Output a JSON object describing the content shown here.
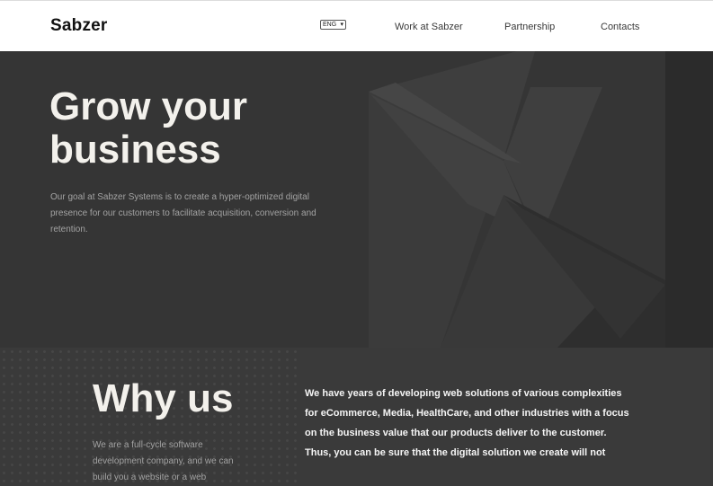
{
  "header": {
    "logo": "Sabzer",
    "language": "ENG",
    "nav": {
      "work": "Work at Sabzer",
      "partnership": "Partnership",
      "contacts": "Contacts"
    }
  },
  "hero": {
    "title": "Grow your business",
    "description": "Our goal at Sabzer Systems is to create a hyper-optimized digital presence for our customers to facilitate acquisition, conversion and retention."
  },
  "why": {
    "title": "Why us",
    "subtitle": "We are a full-cycle software development company, and we can build you a website or a web",
    "body_line1": "We have years of developing web solutions of various complexities for eCommerce, Media, HealthCare, and other industries with a focus on the business value that our products deliver to the customer.",
    "body_line2": "Thus, you can be sure that the digital solution we create will not"
  },
  "colors": {
    "hero_bg": "#353535",
    "why_bg": "#3a3a3a",
    "heading": "#f3f1ec",
    "muted_text": "#a3a3a3"
  },
  "icons": {
    "language_dropdown": "chevron-down-icon"
  }
}
